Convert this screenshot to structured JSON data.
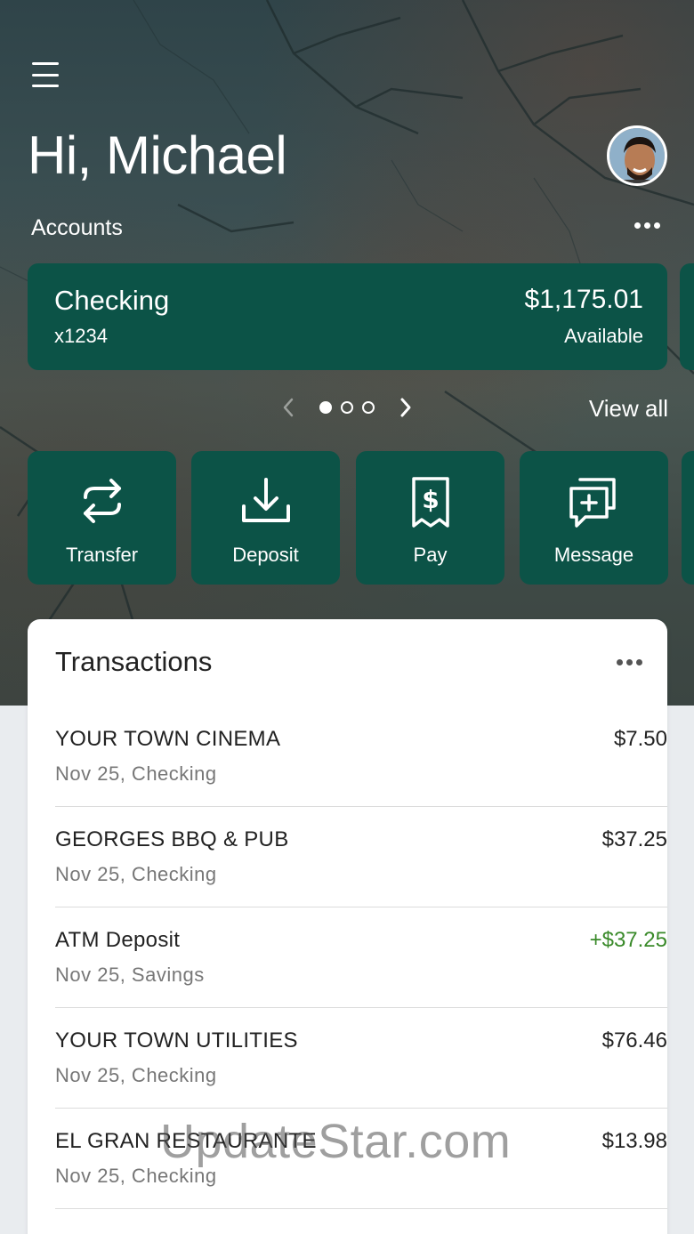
{
  "header": {
    "greeting": "Hi, Michael",
    "accounts_label": "Accounts"
  },
  "account": {
    "name": "Checking",
    "number": "x1234",
    "balance": "$1,175.01",
    "balance_label": "Available"
  },
  "pager": {
    "page_count": 3,
    "current_page": 1,
    "view_all": "View all"
  },
  "actions": [
    {
      "label": "Transfer",
      "icon": "transfer-icon"
    },
    {
      "label": "Deposit",
      "icon": "deposit-icon"
    },
    {
      "label": "Pay",
      "icon": "pay-bill-icon"
    },
    {
      "label": "Message",
      "icon": "message-icon"
    }
  ],
  "transactions": {
    "title": "Transactions",
    "items": [
      {
        "name": "YOUR TOWN CINEMA",
        "detail": "Nov 25, Checking",
        "amount": "$7.50"
      },
      {
        "name": "GEORGES BBQ & PUB",
        "detail": "Nov 25, Checking",
        "amount": "$37.25"
      },
      {
        "name": "ATM Deposit",
        "detail": "Nov 25, Savings",
        "amount": "+$37.25"
      },
      {
        "name": "YOUR TOWN UTILITIES",
        "detail": "Nov 25, Checking",
        "amount": "$76.46"
      },
      {
        "name": "EL GRAN RESTAURANTE",
        "detail": "Nov 25, Checking",
        "amount": "$13.98"
      }
    ]
  },
  "watermark": "UpdateStar.com",
  "colors": {
    "card_green": "#0c5347",
    "positive_amount": "#3a8a2a"
  }
}
